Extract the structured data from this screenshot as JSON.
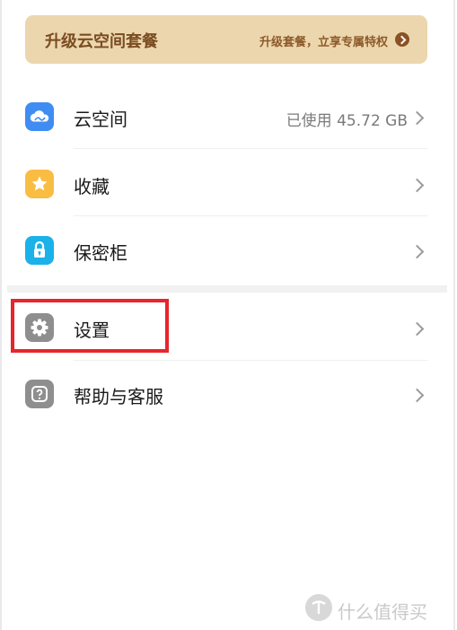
{
  "banner": {
    "title": "升级云空间套餐",
    "subtitle": "升级套餐，立享专属特权",
    "colors": {
      "background": "#ecd6ad",
      "text": "#7a4c22",
      "arrow": "#8a5223"
    }
  },
  "menu": {
    "items": [
      {
        "label": "云空间",
        "value": "已使用 45.72 GB",
        "icon": "cloud-icon",
        "icon_color": "#3f8df3"
      },
      {
        "label": "收藏",
        "value": "",
        "icon": "star-icon",
        "icon_color": "#f9bd43"
      },
      {
        "label": "保密柜",
        "value": "",
        "icon": "lock-icon",
        "icon_color": "#1ab2e8"
      },
      {
        "label": "设置",
        "value": "",
        "icon": "gear-icon",
        "icon_color": "#8e8e8e"
      },
      {
        "label": "帮助与客服",
        "value": "",
        "icon": "help-icon",
        "icon_color": "#8e8e8e"
      }
    ]
  },
  "highlight": {
    "target": "设置",
    "color": "#e8242c"
  },
  "watermark": {
    "text": "什么值得买",
    "icon": "smzdm-logo-icon"
  }
}
